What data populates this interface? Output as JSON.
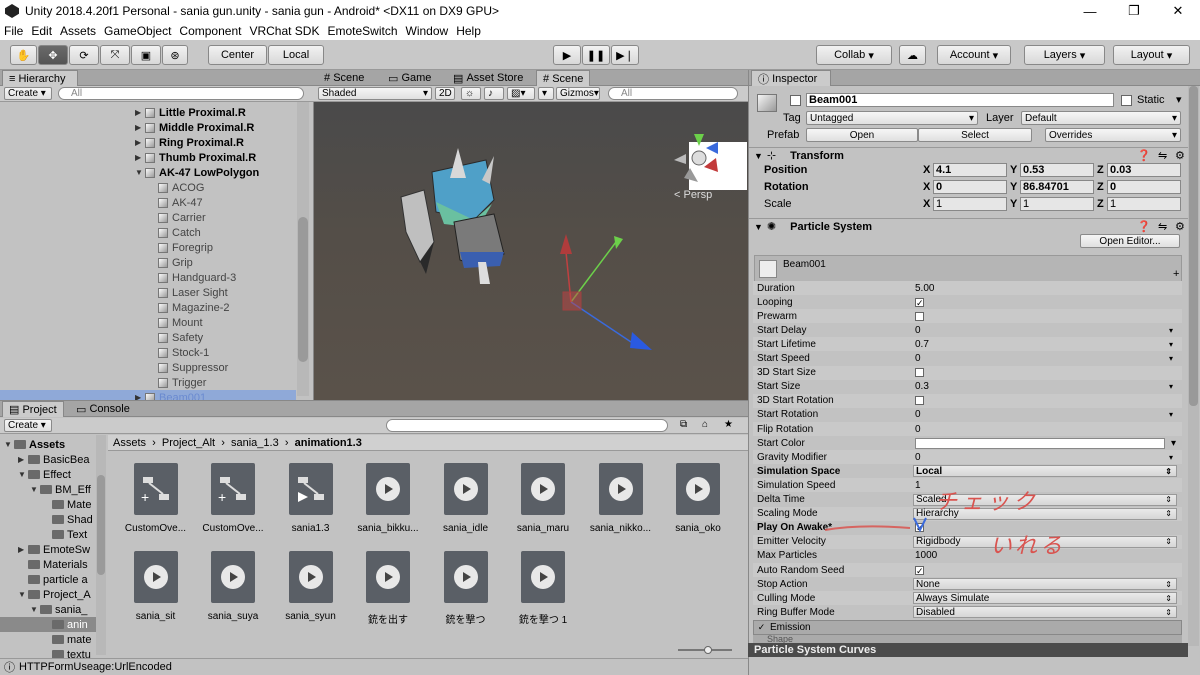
{
  "window": {
    "title": "Unity 2018.4.20f1 Personal - sania gun.unity - sania gun - Android* <DX11 on DX9 GPU>"
  },
  "menu": [
    "File",
    "Edit",
    "Assets",
    "GameObject",
    "Component",
    "VRChat SDK",
    "EmoteSwitch",
    "Window",
    "Help"
  ],
  "toolbar": {
    "center": "Center",
    "local": "Local",
    "collab": "Collab",
    "account": "Account",
    "layers": "Layers",
    "layout": "Layout"
  },
  "hierarchy": {
    "tab": "Hierarchy",
    "create": "Create",
    "search_placeholder": "All",
    "items": [
      {
        "label": "Little Proximal.R",
        "indent": 1,
        "arrow": "▶"
      },
      {
        "label": "Middle Proximal.R",
        "indent": 1,
        "arrow": "▶"
      },
      {
        "label": "Ring Proximal.R",
        "indent": 1,
        "arrow": "▶"
      },
      {
        "label": "Thumb Proximal.R",
        "indent": 1,
        "arrow": "▶"
      },
      {
        "label": "AK-47 LowPolygon",
        "indent": 1,
        "arrow": "▼"
      },
      {
        "label": "ACOG",
        "indent": 2,
        "arrow": ""
      },
      {
        "label": "AK-47",
        "indent": 2,
        "arrow": ""
      },
      {
        "label": "Carrier",
        "indent": 2,
        "arrow": ""
      },
      {
        "label": "Catch",
        "indent": 2,
        "arrow": ""
      },
      {
        "label": "Foregrip",
        "indent": 2,
        "arrow": ""
      },
      {
        "label": "Grip",
        "indent": 2,
        "arrow": ""
      },
      {
        "label": "Handguard-3",
        "indent": 2,
        "arrow": ""
      },
      {
        "label": "Laser Sight",
        "indent": 2,
        "arrow": ""
      },
      {
        "label": "Magazine-2",
        "indent": 2,
        "arrow": ""
      },
      {
        "label": "Mount",
        "indent": 2,
        "arrow": ""
      },
      {
        "label": "Safety",
        "indent": 2,
        "arrow": ""
      },
      {
        "label": "Stock-1",
        "indent": 2,
        "arrow": ""
      },
      {
        "label": "Suppressor",
        "indent": 2,
        "arrow": ""
      },
      {
        "label": "Trigger",
        "indent": 2,
        "arrow": ""
      },
      {
        "label": "Beam001",
        "indent": 1,
        "arrow": "▶",
        "selected": true
      }
    ]
  },
  "scene": {
    "tabs": [
      "Scene",
      "Game",
      "Asset Store",
      "Scene"
    ],
    "shading": "Shaded",
    "mode_2d": "2D",
    "gizmos": "Gizmos",
    "search_placeholder": "All",
    "persp": "< Persp"
  },
  "project": {
    "tabs": [
      "Project",
      "Console"
    ],
    "create": "Create",
    "breadcrumb": [
      "Assets",
      "Project_Alt",
      "sania_1.3",
      "animation1.3"
    ],
    "tree": [
      {
        "label": "Assets",
        "bold": true
      },
      {
        "label": "BasicBea"
      },
      {
        "label": "Effect"
      },
      {
        "label": "BM_Eff"
      },
      {
        "label": "Mate"
      },
      {
        "label": "Shad"
      },
      {
        "label": "Text"
      },
      {
        "label": "EmoteSw"
      },
      {
        "label": "Materials"
      },
      {
        "label": "particle a"
      },
      {
        "label": "Project_A"
      },
      {
        "label": "sania_"
      },
      {
        "label": "anin"
      },
      {
        "label": "mate"
      },
      {
        "label": "textu"
      }
    ],
    "assets": [
      {
        "name": "CustomOve...",
        "kind": "controller"
      },
      {
        "name": "CustomOve...",
        "kind": "controller"
      },
      {
        "name": "sania1.3",
        "kind": "controller2"
      },
      {
        "name": "sania_bikku...",
        "kind": "clip"
      },
      {
        "name": "sania_idle",
        "kind": "clip"
      },
      {
        "name": "sania_maru",
        "kind": "clip"
      },
      {
        "name": "sania_nikko...",
        "kind": "clip"
      },
      {
        "name": "sania_oko",
        "kind": "clip"
      },
      {
        "name": "sania_sit",
        "kind": "clip"
      },
      {
        "name": "sania_suya",
        "kind": "clip"
      },
      {
        "name": "sania_syun",
        "kind": "clip"
      },
      {
        "name": "銃を出す",
        "kind": "clip"
      },
      {
        "name": "銃を撃つ",
        "kind": "clip"
      },
      {
        "name": "銃を撃つ 1",
        "kind": "clip"
      }
    ]
  },
  "status": {
    "text": "HTTPFormUseage:UrlEncoded"
  },
  "inspector": {
    "tab": "Inspector",
    "object_name": "Beam001",
    "static": "Static",
    "tag_label": "Tag",
    "tag": "Untagged",
    "layer_label": "Layer",
    "layer": "Default",
    "prefab_label": "Prefab",
    "prefab_open": "Open",
    "prefab_select": "Select",
    "prefab_overrides": "Overrides",
    "transform": {
      "title": "Transform",
      "position": {
        "label": "Position",
        "x": "4.1",
        "y": "0.53",
        "z": "0.03"
      },
      "rotation": {
        "label": "Rotation",
        "x": "0",
        "y": "86.84701",
        "z": "0"
      },
      "scale": {
        "label": "Scale",
        "x": "1",
        "y": "1",
        "z": "1"
      }
    },
    "particle": {
      "title": "Particle System",
      "open_editor": "Open Editor...",
      "module_name": "Beam001",
      "rows": [
        {
          "label": "Duration",
          "value": "5.00",
          "type": "text"
        },
        {
          "label": "Looping",
          "value": "✓",
          "type": "check"
        },
        {
          "label": "Prewarm",
          "value": "",
          "type": "check"
        },
        {
          "label": "Start Delay",
          "value": "0",
          "type": "drop"
        },
        {
          "label": "Start Lifetime",
          "value": "0.7",
          "type": "drop"
        },
        {
          "label": "Start Speed",
          "value": "0",
          "type": "drop"
        },
        {
          "label": "3D Start Size",
          "value": "",
          "type": "check"
        },
        {
          "label": "Start Size",
          "value": "0.3",
          "type": "drop"
        },
        {
          "label": "3D Start Rotation",
          "value": "",
          "type": "check"
        },
        {
          "label": "Start Rotation",
          "value": "0",
          "type": "drop"
        },
        {
          "label": "Flip Rotation",
          "value": "0",
          "type": "text"
        },
        {
          "label": "Start Color",
          "value": "",
          "type": "color"
        },
        {
          "label": "Gravity Modifier",
          "value": "0",
          "type": "drop"
        },
        {
          "label": "Simulation Space",
          "value": "Local",
          "type": "select",
          "bold": true
        },
        {
          "label": "Simulation Speed",
          "value": "1",
          "type": "text"
        },
        {
          "label": "Delta Time",
          "value": "Scaled",
          "type": "select"
        },
        {
          "label": "Scaling Mode",
          "value": "Hierarchy",
          "type": "select"
        },
        {
          "label": "Play On Awake*",
          "value": "✓",
          "type": "check",
          "bold": true
        },
        {
          "label": "Emitter Velocity",
          "value": "Rigidbody",
          "type": "select"
        },
        {
          "label": "Max Particles",
          "value": "1000",
          "type": "text"
        },
        {
          "label": "Auto Random Seed",
          "value": "✓",
          "type": "check"
        },
        {
          "label": "Stop Action",
          "value": "None",
          "type": "select"
        },
        {
          "label": "Culling Mode",
          "value": "Always Simulate",
          "type": "select"
        },
        {
          "label": "Ring Buffer Mode",
          "value": "Disabled",
          "type": "select"
        }
      ],
      "emission": "Emission",
      "shape": "Shape"
    },
    "curves": "Particle System Curves",
    "annotation": {
      "line1": "チェック",
      "line2": "いれる",
      "color": "#d9534f"
    }
  }
}
